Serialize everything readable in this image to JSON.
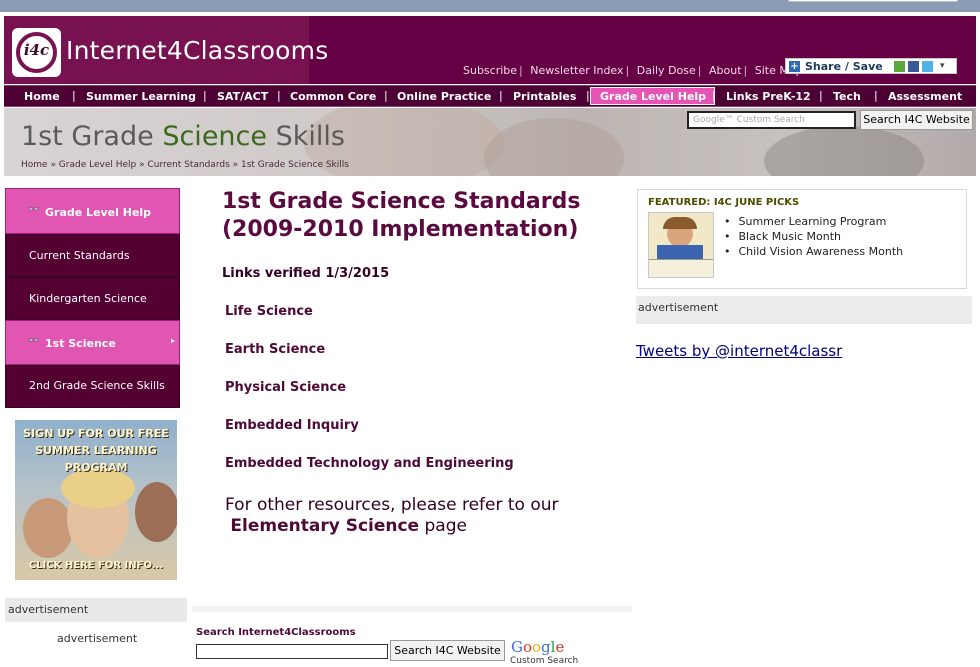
{
  "header": {
    "logo_badge": "i4c",
    "logo_text": "Internet4Classrooms",
    "top_links": [
      "Subscribe",
      "Newsletter Index",
      "Daily Dose",
      "About",
      "Site Map"
    ],
    "share_label": "Share / Save"
  },
  "nav": {
    "items": [
      "Home",
      "Summer Learning",
      "SAT/ACT",
      "Common Core",
      "Online Practice",
      "Printables",
      "Grade Level Help",
      "Links PreK-12",
      "Tech",
      "Assessment"
    ],
    "active": "Grade Level Help"
  },
  "banner": {
    "title_prefix": "1st Grade ",
    "title_highlight": "Science",
    "title_suffix": " Skills",
    "breadcrumb": "Home  »  Grade Level Help  »  Current Standards  »  1st Grade Science Skills",
    "search_placeholder": "Google™ Custom Search",
    "search_button": "Search I4C Website"
  },
  "sidebar": {
    "items": [
      {
        "label": "Grade Level Help",
        "style": "pink"
      },
      {
        "label": "Current Standards",
        "style": "dark"
      },
      {
        "label": "Kindergarten Science",
        "style": "dark"
      },
      {
        "label": "1st Science",
        "style": "pink"
      },
      {
        "label": "2nd Grade Science Skills",
        "style": "dark"
      }
    ],
    "promo_text": "SIGN UP FOR OUR FREE SUMMER LEARNING PROGRAM",
    "promo_footer": "CLICK HERE FOR INFO...",
    "advertisement": "advertisement",
    "advertisement2": "advertisement"
  },
  "main": {
    "title": "1st Grade Science Standards (2009-2010 Implementation)",
    "verified": "Links verified 1/3/2015",
    "links": [
      "Life Science",
      "Earth Science",
      "Physical Science",
      "Embedded Inquiry",
      "Embedded Technology and Engineering"
    ],
    "other_text": "For other resources, please refer to our",
    "other_link": "Elementary Science",
    "other_suffix": " page"
  },
  "bottom_search": {
    "label": "Search Internet4Classrooms",
    "button": "Search I4C Website",
    "google_sub": "Custom Search"
  },
  "right": {
    "featured_title": "FEATURED: I4C JUNE PICKS",
    "featured_items": [
      "Summer Learning Program",
      "Black Music Month",
      "Child Vision Awareness Month"
    ],
    "advertisement": "advertisement",
    "tweets_link": "Tweets by @internet4classr"
  },
  "colors": {
    "brand": "#660044",
    "nav_bg": "#4d0033",
    "active_pink": "#e155b3",
    "link": "#00007f"
  }
}
